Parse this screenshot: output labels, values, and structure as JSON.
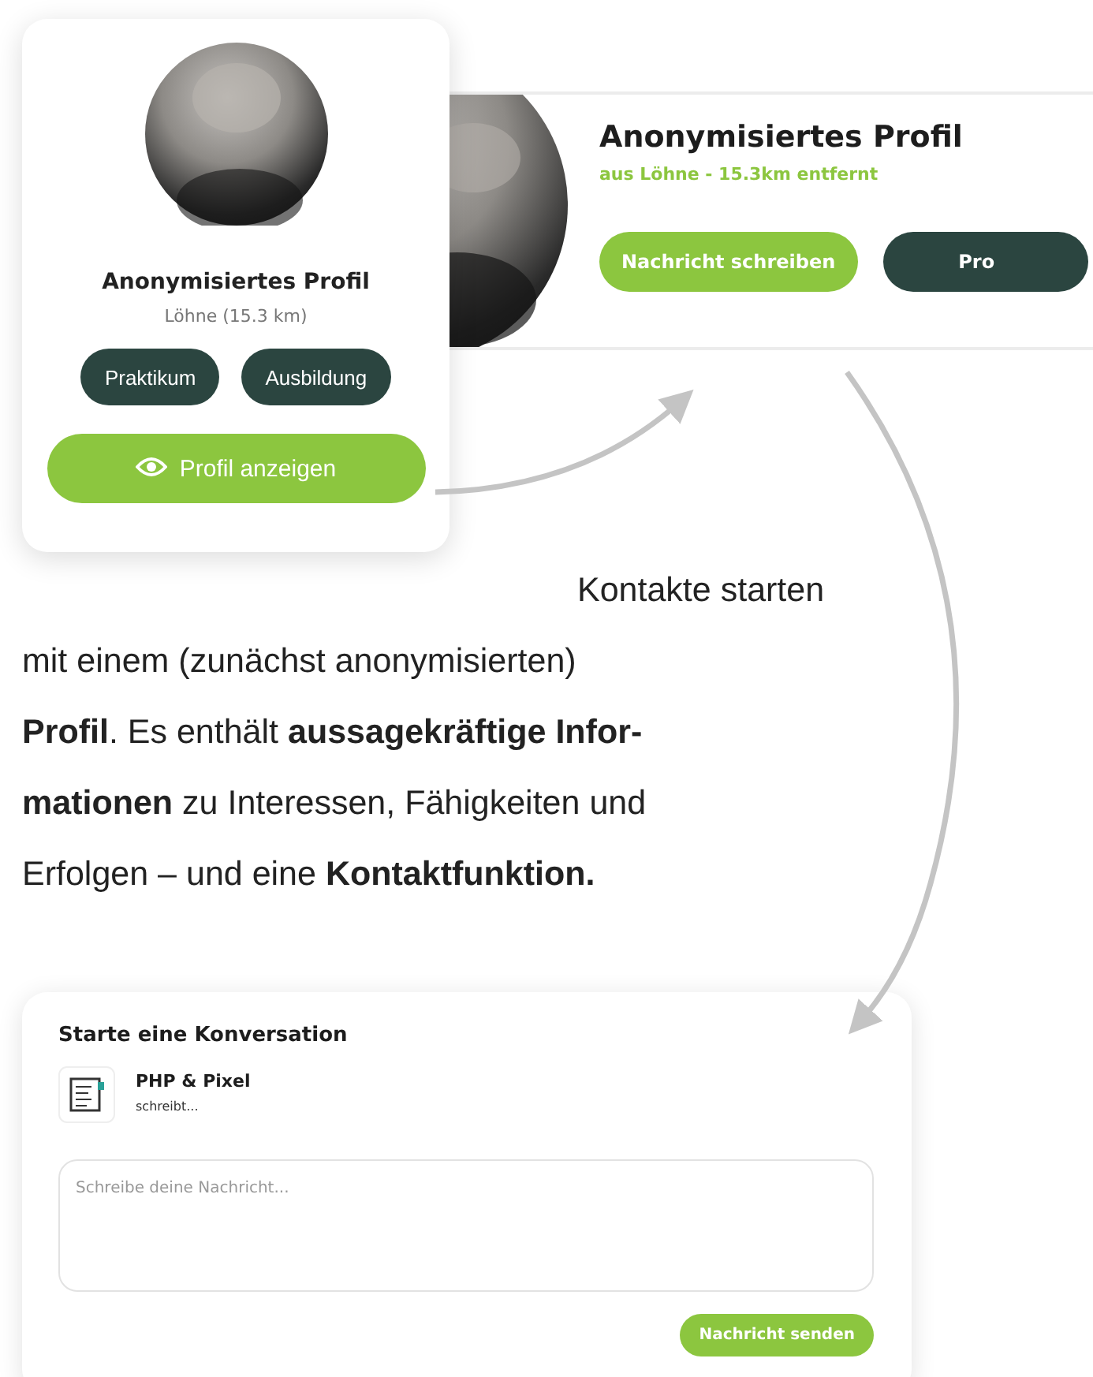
{
  "profile_banner": {
    "name": "Anonymisiertes Profil",
    "location": "aus Löhne - 15.3km entfernt",
    "buttons": [
      {
        "label": "Nachricht schreiben",
        "kind": "primary"
      },
      {
        "label": "Pro",
        "kind": "secondary"
      }
    ]
  },
  "profile_card": {
    "name": "Anonymisiertes Profil",
    "location": "Löhne (15.3 km)",
    "tags": [
      "Praktikum",
      "Ausbildung"
    ],
    "button": "Profil anzeigen"
  },
  "description": "Kontakte starten\nmit einem (zunächst anonymisierten)\n**Profil**. Es enthält **aussagekräftige Infor-**\n**mationen** zu Interessen, Fähigkeiten und\nErfolgen – und eine **Kontaktfunktion.**",
  "conversation": {
    "title": "Starte eine Konversation",
    "sender": "PHP & Pixel",
    "status": "schreibt...",
    "message": {
      "placeholder": "Schreibe deine Nachricht..."
    },
    "button": "Nachricht senden"
  }
}
